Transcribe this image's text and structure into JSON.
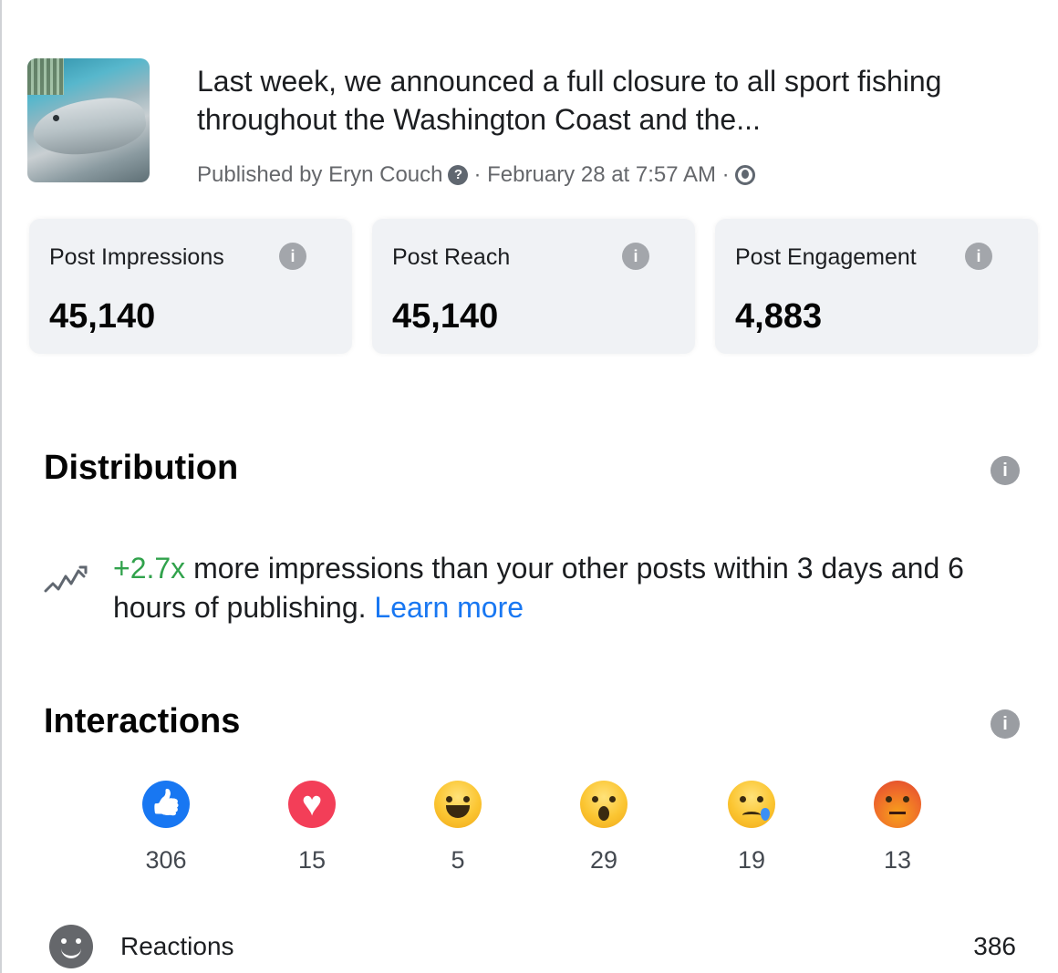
{
  "post": {
    "title": "Last week, we announced a full closure to all sport fishing throughout the Washington Coast and the...",
    "published_by": "Published by Eryn Couch",
    "date": "· February 28 at 7:57 AM ·"
  },
  "stats": [
    {
      "label": "Post Impressions",
      "value": "45,140"
    },
    {
      "label": "Post Reach",
      "value": "45,140"
    },
    {
      "label": "Post Engagement",
      "value": "4,883"
    }
  ],
  "distribution": {
    "title": "Distribution",
    "multiplier": "+2.7x",
    "text": " more impressions than your other posts within 3 days and 6 hours of publishing. ",
    "link": "Learn more"
  },
  "interactions": {
    "title": "Interactions",
    "reactions": [
      {
        "type": "like",
        "count": "306"
      },
      {
        "type": "love",
        "count": "15"
      },
      {
        "type": "haha",
        "count": "5"
      },
      {
        "type": "wow",
        "count": "29"
      },
      {
        "type": "sad",
        "count": "19"
      },
      {
        "type": "angry",
        "count": "13"
      }
    ],
    "reactions_label": "Reactions",
    "reactions_total": "386"
  },
  "icons": {
    "info": "info-icon",
    "question": "question-icon",
    "globe": "globe-icon",
    "trend": "trend-icon",
    "smiley": "smiley-icon"
  },
  "colors": {
    "link": "#1877f2",
    "positive": "#31a24c",
    "card_bg": "#f0f2f5"
  }
}
